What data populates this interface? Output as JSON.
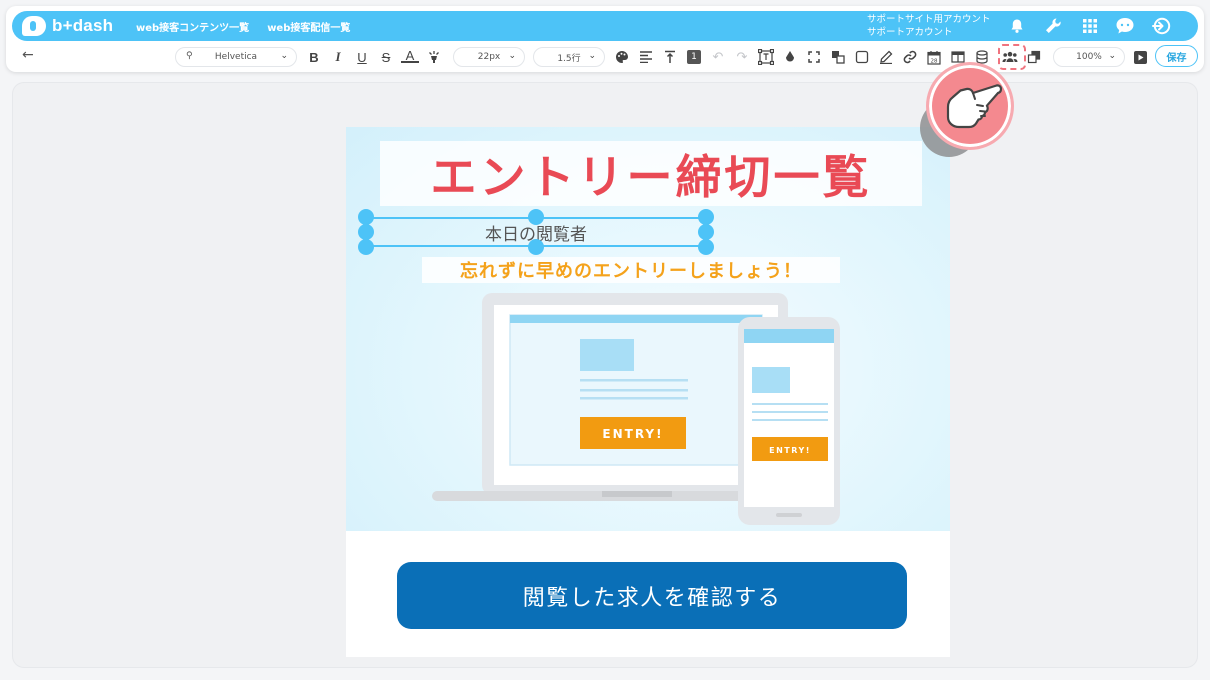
{
  "header": {
    "logo_text": "b+dash",
    "nav": [
      "web接客コンテンツ一覧",
      "web接客配信一覧"
    ],
    "account_line1": "サポートサイト用アカウント",
    "account_line2": "サポートアカウント"
  },
  "toolbar": {
    "back_icon": "←",
    "font_family": "Helvetica",
    "font_size": "22px",
    "line_height": "1.5行",
    "badge": "1",
    "zoom": "100%",
    "save_label": "保存"
  },
  "content": {
    "title": "エントリー締切一覧",
    "subtitle": "本日の閲覧者",
    "tagline": "忘れずに早めのエントリーしましょう！",
    "entry_label": "ENTRY!",
    "cta_label": "閲覧した求人を確認する"
  },
  "colors": {
    "brand": "#4dc3f7",
    "title_red": "#e94a55",
    "tag_orange": "#f4a21b",
    "cta_blue": "#0a6fb7",
    "highlight": "#f0737e"
  }
}
